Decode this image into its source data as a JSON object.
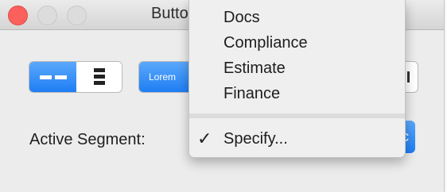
{
  "window": {
    "title": "Butto"
  },
  "segments": {
    "second_control_first_label": "Lorem"
  },
  "active_segment_label": "Active Segment:",
  "popup_tail_glyph": "c",
  "menu": {
    "items": [
      {
        "label": "Docs"
      },
      {
        "label": "Compliance"
      },
      {
        "label": "Estimate"
      },
      {
        "label": "Finance"
      }
    ],
    "selected_item": {
      "label": "Specify...",
      "check": "✓"
    }
  },
  "colors": {
    "accent": "#1f7ef4",
    "close": "#fc605c"
  }
}
